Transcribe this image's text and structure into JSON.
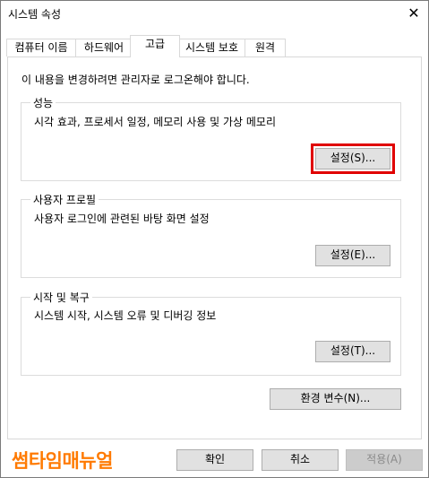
{
  "window": {
    "title": "시스템 속성",
    "close_glyph": "✕"
  },
  "tabs": [
    {
      "label": "컴퓨터 이름"
    },
    {
      "label": "하드웨어"
    },
    {
      "label": "고급",
      "active": true
    },
    {
      "label": "시스템 보호"
    },
    {
      "label": "원격"
    }
  ],
  "notice": "이 내용을 변경하려면 관리자로 로그온해야 합니다.",
  "performance": {
    "title": "성능",
    "desc": "시각 효과, 프로세서 일정, 메모리 사용 및 가상 메모리",
    "button": "설정(S)..."
  },
  "profile": {
    "title": "사용자 프로필",
    "desc": "사용자 로그인에 관련된 바탕 화면 설정",
    "button": "설정(E)..."
  },
  "startup": {
    "title": "시작 및 복구",
    "desc": "시스템 시작, 시스템 오류 및 디버깅 정보",
    "button": "설정(T)..."
  },
  "env_button": "환경 변수(N)...",
  "footer": {
    "ok": "확인",
    "cancel": "취소",
    "apply": "적용(A)",
    "watermark": "썸타임매뉴얼"
  },
  "colors": {
    "highlight": "#e00000",
    "watermark": "#ff7a00"
  }
}
